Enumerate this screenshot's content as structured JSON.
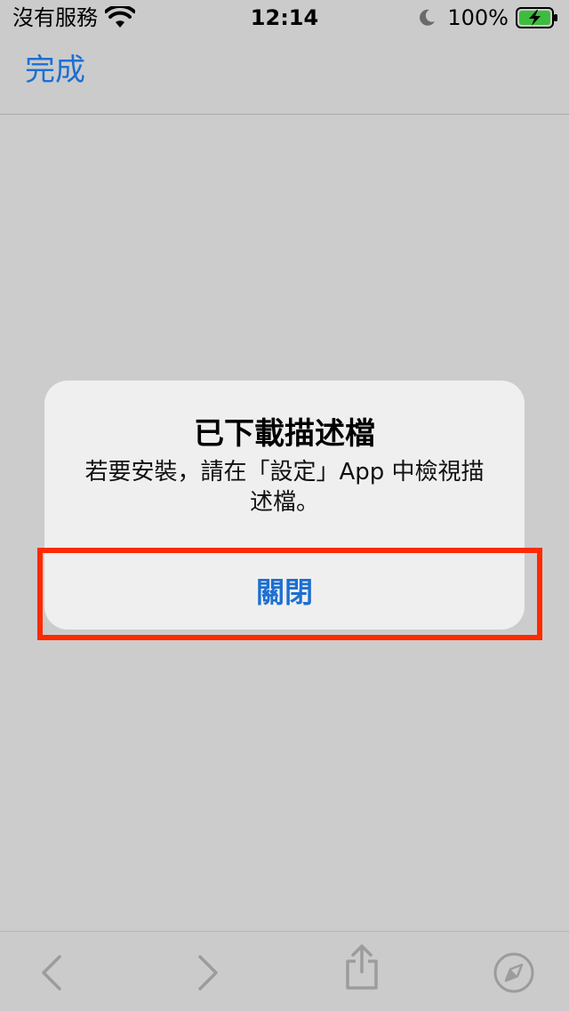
{
  "status_bar": {
    "carrier": "沒有服務",
    "time": "12:14",
    "battery_percent": "100%"
  },
  "nav": {
    "done_label": "完成"
  },
  "alert": {
    "title": "已下載描述檔",
    "message_line1": "若要安裝，請在「設定」App 中檢視描",
    "message_line2": "述檔。",
    "button_label": "關閉"
  },
  "colors": {
    "accent": "#1d6fd1",
    "highlight": "#ff2a00",
    "background": "#cccccc"
  },
  "toolbar": {
    "icons": [
      "chevron-left-icon",
      "chevron-right-icon",
      "share-icon",
      "compass-icon"
    ]
  }
}
